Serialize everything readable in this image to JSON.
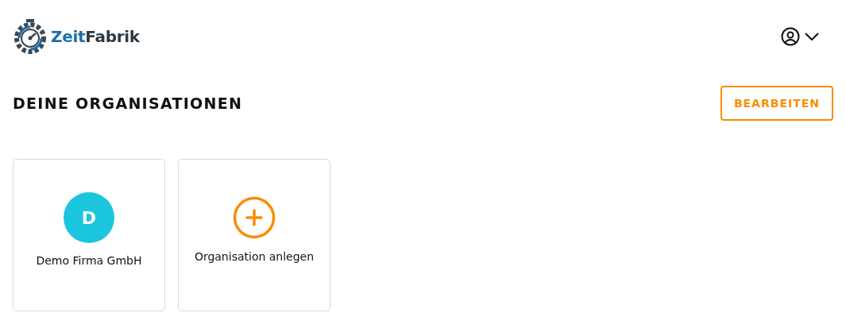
{
  "logo": {
    "first": "Zeit",
    "second": "Fabrik"
  },
  "page_title": "DEINE ORGANISATIONEN",
  "edit_button": "BEARBEITEN",
  "cards": [
    {
      "kind": "organization",
      "initial": "D",
      "color": "#1bc5de",
      "label": "Demo Firma GmbH"
    },
    {
      "kind": "add",
      "label": "Organisation anlegen"
    }
  ]
}
